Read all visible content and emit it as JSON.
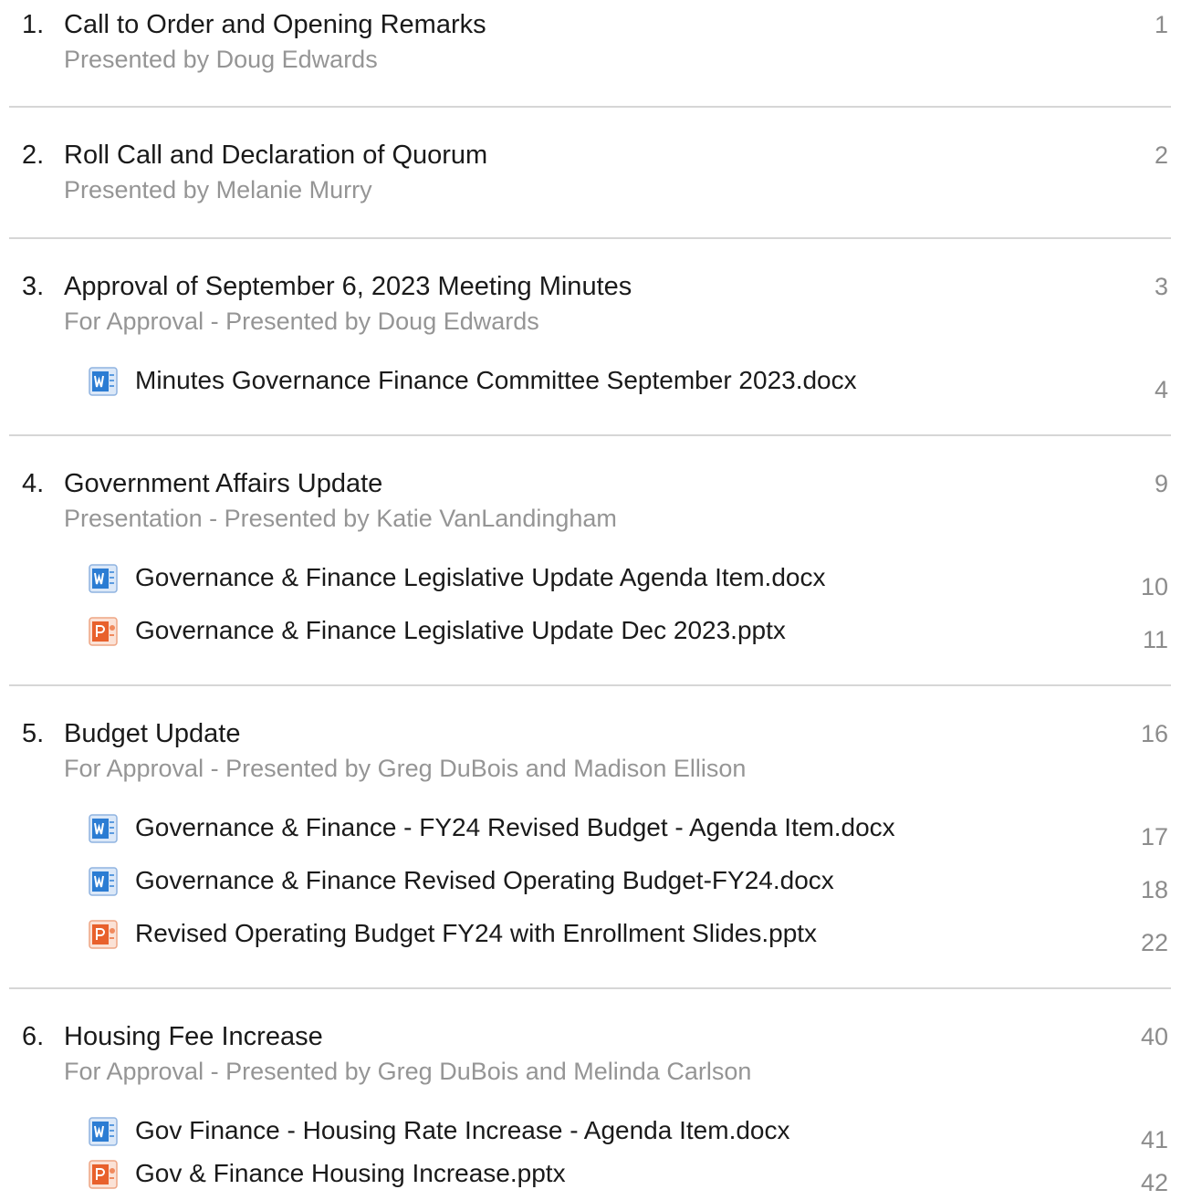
{
  "agenda": {
    "items": [
      {
        "number": "1.",
        "title": "Call to Order and Opening Remarks",
        "subtitle": "Presented by Doug Edwards",
        "page": "1",
        "attachments": []
      },
      {
        "number": "2.",
        "title": "Roll Call and Declaration of Quorum",
        "subtitle": "Presented by Melanie Murry",
        "page": "2",
        "attachments": []
      },
      {
        "number": "3.",
        "title": "Approval of September 6, 2023 Meeting Minutes",
        "subtitle": "For Approval - Presented by Doug Edwards",
        "page": "3",
        "attachments": [
          {
            "name": "Minutes Governance Finance Committee September 2023.docx",
            "page": "4",
            "icon": "word-document-icon",
            "color": "#2b7cd3"
          }
        ]
      },
      {
        "number": "4.",
        "title": "Government Affairs Update",
        "subtitle": "Presentation - Presented by Katie VanLandingham",
        "page": "9",
        "attachments": [
          {
            "name": "Governance & Finance Legislative Update Agenda Item.docx",
            "page": "10",
            "icon": "word-document-icon",
            "color": "#2b7cd3"
          },
          {
            "name": "Governance & Finance Legislative Update Dec 2023.pptx",
            "page": "11",
            "icon": "powerpoint-document-icon",
            "color": "#e8612c"
          }
        ]
      },
      {
        "number": "5.",
        "title": "Budget Update",
        "subtitle": "For Approval - Presented by Greg DuBois and Madison Ellison",
        "page": "16",
        "attachments": [
          {
            "name": "Governance & Finance - FY24 Revised Budget - Agenda Item.docx",
            "page": "17",
            "icon": "word-document-icon",
            "color": "#2b7cd3"
          },
          {
            "name": "Governance & Finance Revised Operating Budget-FY24.docx",
            "page": "18",
            "icon": "word-document-icon",
            "color": "#2b7cd3"
          },
          {
            "name": "Revised Operating Budget FY24 with Enrollment Slides.pptx",
            "page": "22",
            "icon": "powerpoint-document-icon",
            "color": "#e8612c"
          }
        ]
      },
      {
        "number": "6.",
        "title": "Housing Fee Increase",
        "subtitle": "For Approval - Presented by Greg DuBois and Melinda Carlson",
        "page": "40",
        "attachments": [
          {
            "name": "Gov Finance - Housing Rate Increase - Agenda Item.docx",
            "page": "41",
            "icon": "word-document-icon",
            "color": "#2b7cd3"
          },
          {
            "name": "Gov & Finance Housing Increase.pptx",
            "page": "42",
            "icon": "powerpoint-document-icon",
            "color": "#e8612c"
          }
        ]
      }
    ]
  }
}
